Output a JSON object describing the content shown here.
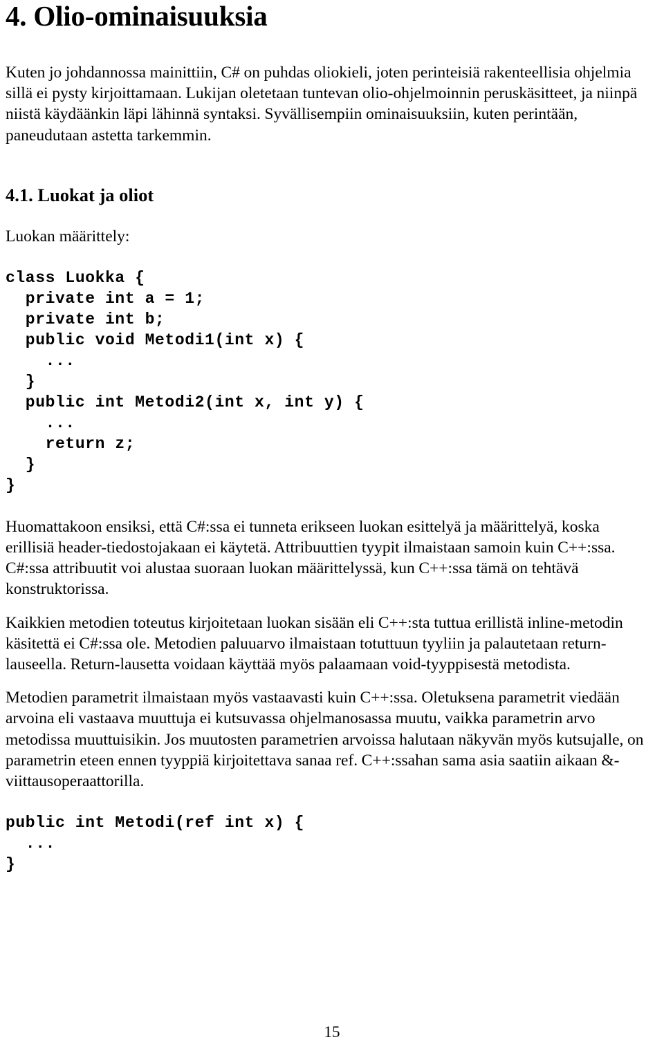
{
  "document": {
    "page_number": "15",
    "language": "fi"
  },
  "chapter": {
    "title": "4. Olio-ominaisuuksia",
    "intro_paragraph": "Kuten jo johdannossa mainittiin, C# on puhdas oliokieli, joten perinteisiä rakenteellisia ohjelmia sillä ei pysty kirjoittamaan. Lukijan oletetaan tuntevan olio-ohjelmoinnin peruskäsitteet, ja niinpä niistä käydäänkin läpi lähinnä syntaksi. Syvällisempiin ominaisuuksiin, kuten perintään, paneudutaan astetta tarkemmin."
  },
  "section": {
    "title": "4.1. Luokat ja oliot",
    "lead_in": "Luokan määrittely:",
    "code_class_definition": "class Luokka {\n  private int a = 1;\n  private int b;\n  public void Metodi1(int x) {\n    ...\n  }\n  public int Metodi2(int x, int y) {\n    ...\n    return z;\n  }\n}",
    "paragraph_1": "Huomattakoon ensiksi, että C#:ssa ei tunneta erikseen luokan esittelyä ja määrittelyä, koska erillisiä header-tiedostojakaan ei käytetä. Attribuuttien tyypit ilmaistaan samoin kuin C++:ssa. C#:ssa attribuutit voi alustaa suoraan luokan määrittelyssä, kun C++:ssa tämä on tehtävä konstruktorissa.",
    "paragraph_2": "Kaikkien metodien toteutus kirjoitetaan luokan sisään eli C++:sta tuttua erillistä inline-metodin käsitettä ei C#:ssa ole. Metodien paluuarvo ilmaistaan totuttuun tyyliin ja palautetaan return-lauseella. Return-lausetta voidaan käyttää myös palaamaan void-tyyppisestä metodista.",
    "paragraph_3": "Metodien parametrit ilmaistaan myös vastaavasti kuin C++:ssa. Oletuksena parametrit viedään arvoina eli vastaava muuttuja ei kutsuvassa ohjelmanosassa muutu, vaikka parametrin arvo metodissa muuttuisikin. Jos muutosten parametrien arvoissa halutaan näkyvän myös kutsujalle, on parametrin eteen ennen tyyppiä kirjoitettava sanaa ref. C++:ssahan sama asia saatiin aikaan &-viittausoperaattorilla.",
    "code_ref_parameter": "public int Metodi(ref int x) {\n  ...\n}"
  }
}
